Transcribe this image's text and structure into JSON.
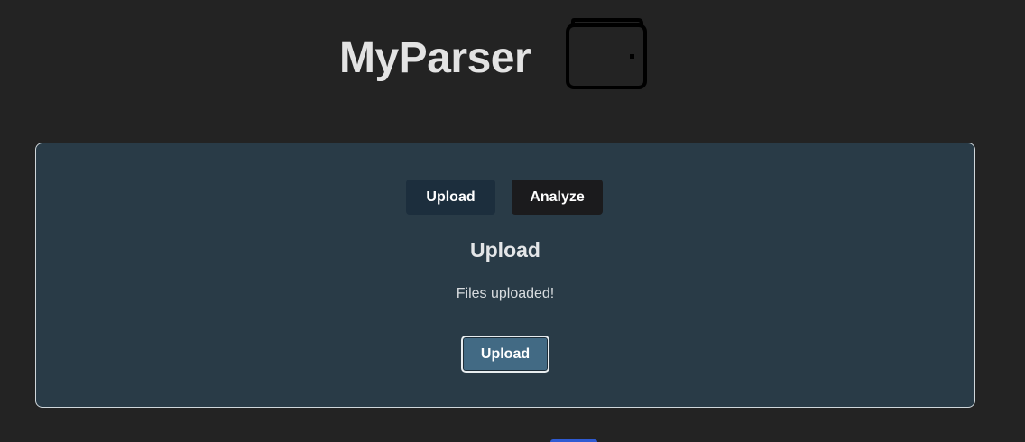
{
  "header": {
    "title": "MyParser",
    "logo_icon": "wallet-icon"
  },
  "panel": {
    "tabs": [
      {
        "label": "Upload"
      },
      {
        "label": "Analyze"
      }
    ],
    "section_title": "Upload",
    "status_message": "Files uploaded!",
    "upload_button_label": "Upload"
  },
  "colors": {
    "background": "#232323",
    "panel": "#293b47",
    "tab_active": "#1c2e3d",
    "tab_inactive": "#1b1b1d",
    "upload_button": "#426a84"
  }
}
